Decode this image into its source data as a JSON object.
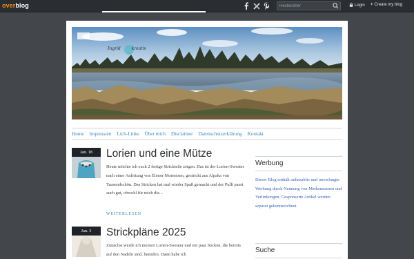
{
  "topbar": {
    "logo_over": "over",
    "logo_blog": "blog",
    "social": [
      {
        "name": "facebook",
        "glyph": "f"
      },
      {
        "name": "x",
        "glyph": "𝕏"
      },
      {
        "name": "pinterest",
        "glyph": "P"
      }
    ],
    "search_placeholder": "Rechercher",
    "login_label": "Login",
    "create_label": "Create my blog"
  },
  "header": {
    "logo_text_left": "Ingrid",
    "logo_text_right": "kreativ"
  },
  "nav": {
    "items": [
      "Home",
      "Impressum",
      "Lich-Links",
      "Über mich",
      "Disclaimer",
      "Datenschutzerklärung",
      "Kontakt"
    ]
  },
  "posts": [
    {
      "date": "Jan. 18",
      "title": "Lorien und eine Mütze",
      "excerpt": "Heute möchte ich euch 2 fertige Strickteile zeigen. Das ist der Lorien-Sweater nach einer Anleitung von Elenor Mortensen, gestrickt aus Alpaka von Tausendschön. Das Stricken hat mal wieder Spaß gemacht und der Pulli passt auch gut, obwohl für mich die...",
      "readmore": "WEITERLESEN"
    },
    {
      "date": "Jan. 3",
      "title": "Strickpläne 2025",
      "excerpt": "Zunächst werde ich meinen Lorien-Sweater und ein paar Socken, die bereits auf den Nadeln sind, beenden. Dann habe ich"
    }
  ],
  "sidebar": {
    "werbung_title": "Werbung",
    "werbung_text": "Dieser Blog enthält unbezahlte und unverlangte Werbung durch Nennung von Markennamen und Verlinkungen. Gesponserte Artikel werden separat gekennzeichnet.",
    "suche_title": "Suche"
  },
  "colors": {
    "link": "#3a84b8",
    "brand_orange": "#f08c1e",
    "topbar": "#2b2e31",
    "background": "#43474c"
  }
}
